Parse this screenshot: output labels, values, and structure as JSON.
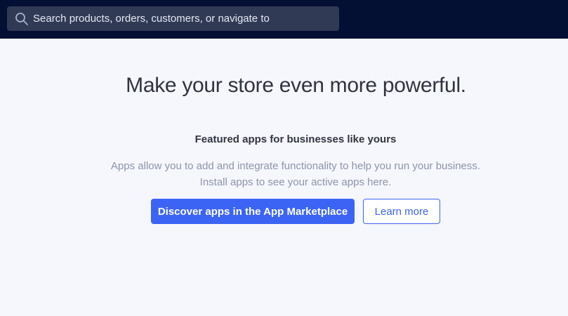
{
  "search": {
    "placeholder": "Search products, orders, customers, or navigate to",
    "icon": "search-icon"
  },
  "main": {
    "title": "Make your store even more powerful.",
    "featured_heading": "Featured apps for businesses like yours",
    "description_line1": "Apps allow you to add and integrate functionality to help you run your business.",
    "description_line2": "Install apps to see your active apps here.",
    "primary_button": "Discover apps in the App Marketplace",
    "secondary_button": "Learn more"
  },
  "colors": {
    "topbar": "#030f33",
    "search_bg": "#303a55",
    "page_bg": "#f5f7fc",
    "accent": "#3c64f4",
    "title_text": "#313440",
    "muted_text": "#8c93ad"
  }
}
